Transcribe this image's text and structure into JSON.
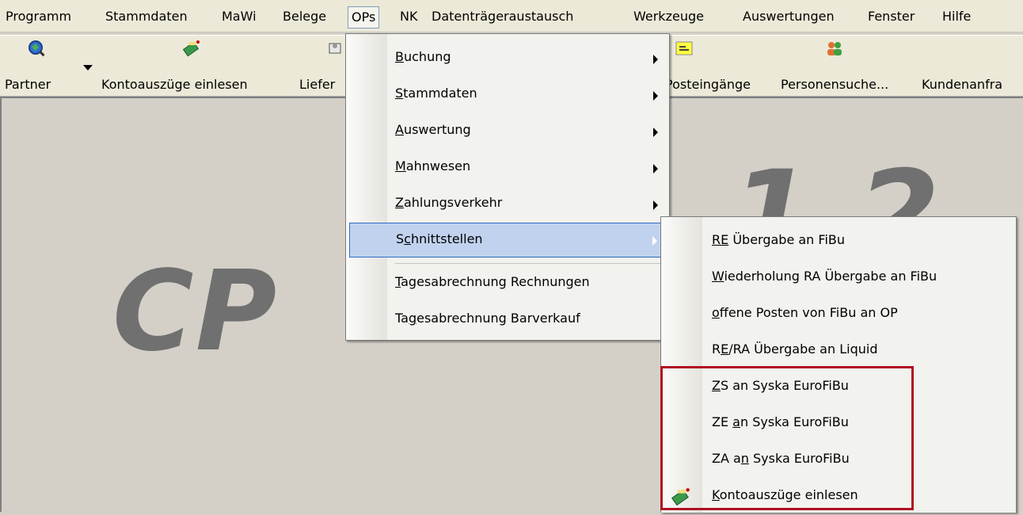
{
  "menubar": [
    {
      "label": "Programm"
    },
    {
      "label": "Stammdaten"
    },
    {
      "label": "MaWi"
    },
    {
      "label": "Belege"
    },
    {
      "label": "OPs"
    },
    {
      "label": "NK"
    },
    {
      "label": "Datenträgeraustausch"
    },
    {
      "label": "Werkzeuge"
    },
    {
      "label": "Auswertungen"
    },
    {
      "label": "Fenster"
    },
    {
      "label": "Hilfe"
    }
  ],
  "toolbar": {
    "partner": "Partner",
    "kontoauszuege": "Kontoauszüge einlesen",
    "liefer": "Liefer",
    "posteingaenge": "Posteingänge",
    "personensuche": "Personensuche...",
    "kundenanfr": "Kundenanfra"
  },
  "background_text": {
    "left": "CP",
    "right": "1 2 5"
  },
  "ops_menu": {
    "items": [
      {
        "pre": "",
        "u": "B",
        "post": "uchung",
        "submenu": true
      },
      {
        "pre": "",
        "u": "S",
        "post": "tammdaten",
        "submenu": true
      },
      {
        "pre": "",
        "u": "A",
        "post": "uswertung",
        "submenu": true
      },
      {
        "pre": "",
        "u": "M",
        "post": "ahnwesen",
        "submenu": true
      },
      {
        "pre": "",
        "u": "Z",
        "post": "ahlungsverkehr",
        "submenu": true
      },
      {
        "pre": "S",
        "u": "c",
        "post": "hnittstellen",
        "submenu": true
      },
      {
        "pre": "",
        "u": "T",
        "post": "agesabrechnung Rechnungen",
        "submenu": false
      },
      {
        "pre": "Ta",
        "u": "g",
        "post": "esabrechnung Barverkauf",
        "submenu": false
      }
    ]
  },
  "schnittstellen_menu": {
    "items": [
      {
        "pre": "",
        "u": "RE",
        "post": " Übergabe an FiBu"
      },
      {
        "pre": "",
        "u": "W",
        "post": "iederholung RA Übergabe an FiBu"
      },
      {
        "pre": "",
        "u": "o",
        "post": "ffene Posten von FiBu an OP"
      },
      {
        "pre": "R",
        "u": "E",
        "post": "/RA Übergabe an Liquid"
      },
      {
        "pre": "",
        "u": "Z",
        "post": "S an Syska EuroFiBu"
      },
      {
        "pre": "ZE ",
        "u": "a",
        "post": "n Syska EuroFiBu"
      },
      {
        "pre": "ZA a",
        "u": "n",
        "post": " Syska EuroFiBu"
      },
      {
        "pre": "",
        "u": "K",
        "post": "ontoauszüge einlesen"
      }
    ]
  },
  "colors": {
    "highlight_box": "#b01020",
    "menu_highlight": "#c1d2ee"
  }
}
